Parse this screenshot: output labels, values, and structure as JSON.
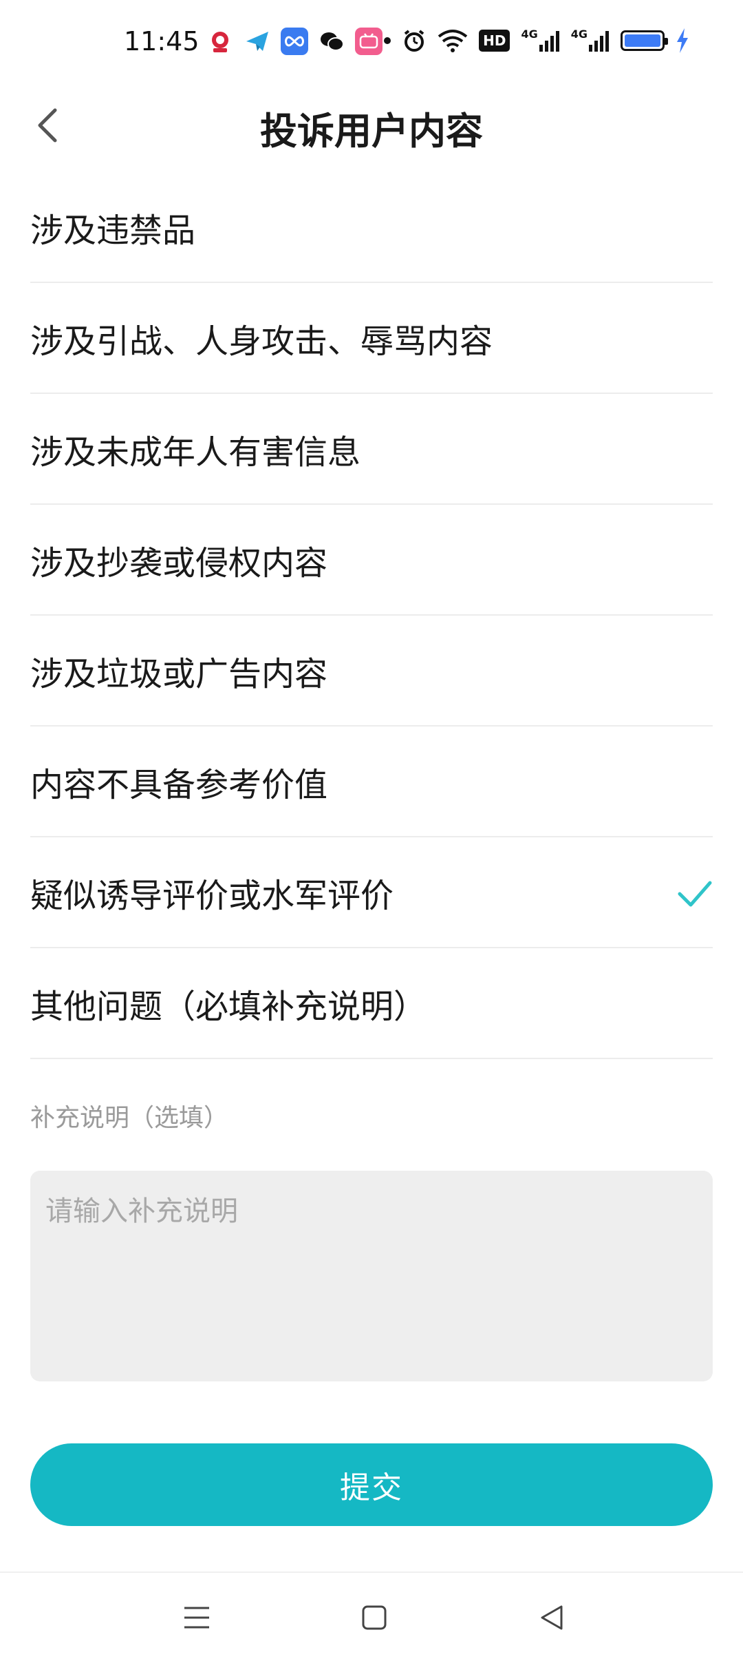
{
  "status_bar": {
    "time": "11:45",
    "app_icons": [
      {
        "name": "baidu-icon",
        "color": "#ffffff",
        "glyph": "🐾"
      },
      {
        "name": "telegram-icon",
        "color": "#2aa3e0",
        "glyph": "➤"
      },
      {
        "name": "infinity-app-icon",
        "color": "#3a7bf0",
        "glyph": "∞"
      },
      {
        "name": "wechat-icon",
        "color": "#ffffff",
        "glyph": "💬"
      },
      {
        "name": "bilibili-icon",
        "color": "#f25d8e",
        "glyph": "b"
      }
    ],
    "hd_label": "HD",
    "signal_label_1": "4G",
    "signal_label_2": "4G"
  },
  "header": {
    "title": "投诉用户内容"
  },
  "reasons": [
    {
      "label": "涉及违禁品",
      "selected": false
    },
    {
      "label": "涉及引战、人身攻击、辱骂内容",
      "selected": false
    },
    {
      "label": "涉及未成年人有害信息",
      "selected": false
    },
    {
      "label": "涉及抄袭或侵权内容",
      "selected": false
    },
    {
      "label": "涉及垃圾或广告内容",
      "selected": false
    },
    {
      "label": "内容不具备参考价值",
      "selected": false
    },
    {
      "label": "疑似诱导评价或水军评价",
      "selected": true
    },
    {
      "label": "其他问题（必填补充说明）",
      "selected": false
    }
  ],
  "supplement": {
    "label": "补充说明（选填）",
    "placeholder": "请输入补充说明",
    "value": ""
  },
  "submit": {
    "label": "提交"
  },
  "colors": {
    "accent": "#15b8c4",
    "check": "#2fc4c9"
  }
}
